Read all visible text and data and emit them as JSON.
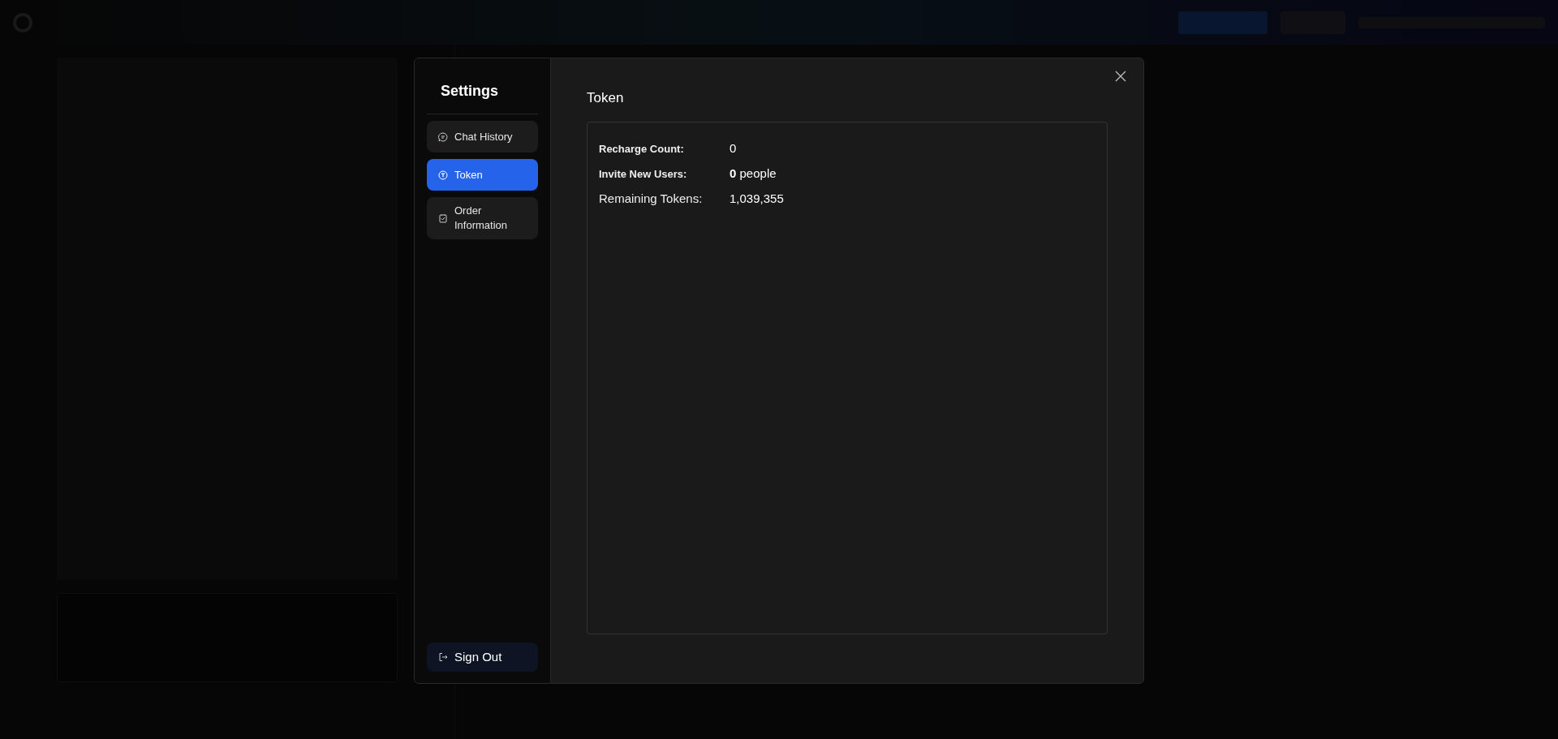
{
  "settings": {
    "title": "Settings",
    "nav": [
      {
        "kind": "chat",
        "label": "Chat History",
        "selected": false
      },
      {
        "kind": "token",
        "label": "Token",
        "selected": true
      },
      {
        "kind": "order",
        "label": "Order Information",
        "selected": false
      }
    ],
    "sign_out": "Sign Out"
  },
  "panel": {
    "title": "Token",
    "stats": [
      {
        "kind": "detail",
        "label": "Recharge Count:",
        "value": "0"
      },
      {
        "kind": "detail",
        "label": "Invite New Users:",
        "value": "**0** people"
      },
      {
        "kind": "total",
        "label": "Remaining Tokens:",
        "value": "1,039,355"
      }
    ]
  }
}
